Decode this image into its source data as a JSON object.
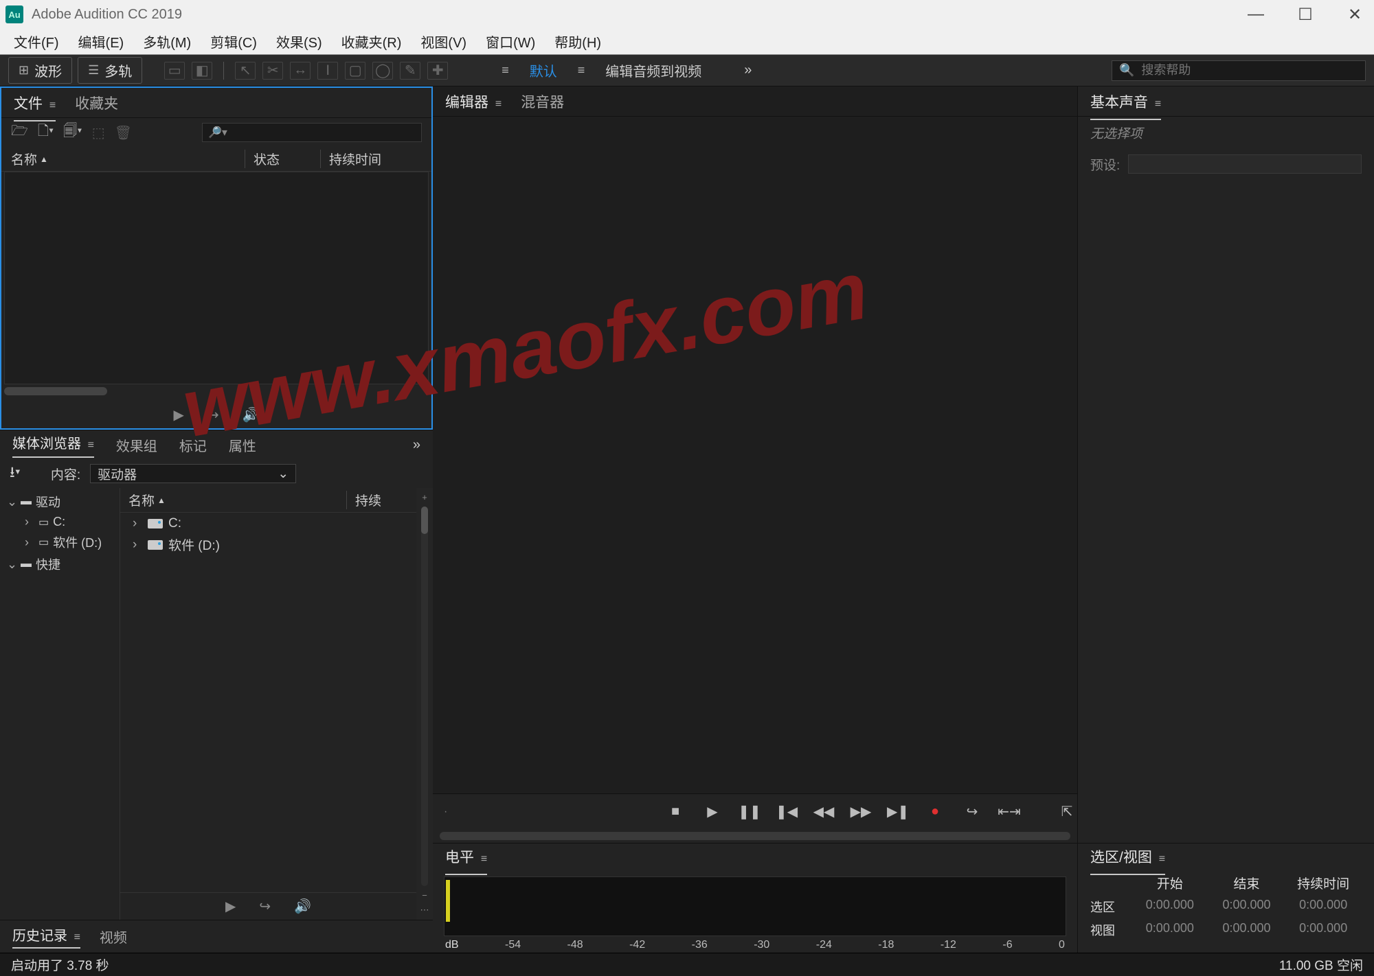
{
  "titlebar": {
    "app_badge": "Au",
    "title": "Adobe Audition CC 2019"
  },
  "menubar": [
    "文件(F)",
    "编辑(E)",
    "多轨(M)",
    "剪辑(C)",
    "效果(S)",
    "收藏夹(R)",
    "视图(V)",
    "窗口(W)",
    "帮助(H)"
  ],
  "toolbar": {
    "waveform_label": "波形",
    "multitrack_label": "多轨",
    "workspace_default": "默认",
    "workspace_edit_av": "编辑音频到视频",
    "search_placeholder": "搜索帮助"
  },
  "panels": {
    "files": {
      "tabs": [
        "文件",
        "收藏夹"
      ],
      "cols": {
        "name": "名称",
        "status": "状态",
        "duration": "持续时间"
      }
    },
    "media": {
      "tabs": [
        "媒体浏览器",
        "效果组",
        "标记",
        "属性"
      ],
      "content_label": "内容:",
      "content_value": "驱动器",
      "cols": {
        "name": "名称",
        "duration": "持续"
      },
      "tree": {
        "drives": "驱动",
        "c": "C:",
        "d_soft": "软件 (D:)",
        "quick": "快捷"
      },
      "list": {
        "c": "C:",
        "d": "软件 (D:)"
      }
    },
    "editor_tabs": [
      "编辑器",
      "混音器"
    ],
    "levels": {
      "title": "电平",
      "db_label": "dB",
      "db_ticks": [
        "-54",
        "-48",
        "-42",
        "-36",
        "-30",
        "-24",
        "-18",
        "-12",
        "-6",
        "0"
      ]
    },
    "essential_sound": {
      "title": "基本声音",
      "no_selection": "无选择项",
      "preset_label": "预设:"
    },
    "selection_view": {
      "title": "选区/视图",
      "headers": {
        "start": "开始",
        "end": "结束",
        "duration": "持续时间"
      },
      "rows": {
        "selection_label": "选区",
        "view_label": "视图",
        "zero": "0:00.000"
      }
    },
    "history": {
      "tabs": [
        "历史记录",
        "视频"
      ]
    }
  },
  "statusbar": {
    "left": "启动用了 3.78 秒",
    "right": "11.00 GB 空闲"
  },
  "watermark": "www.xmaofx.com"
}
